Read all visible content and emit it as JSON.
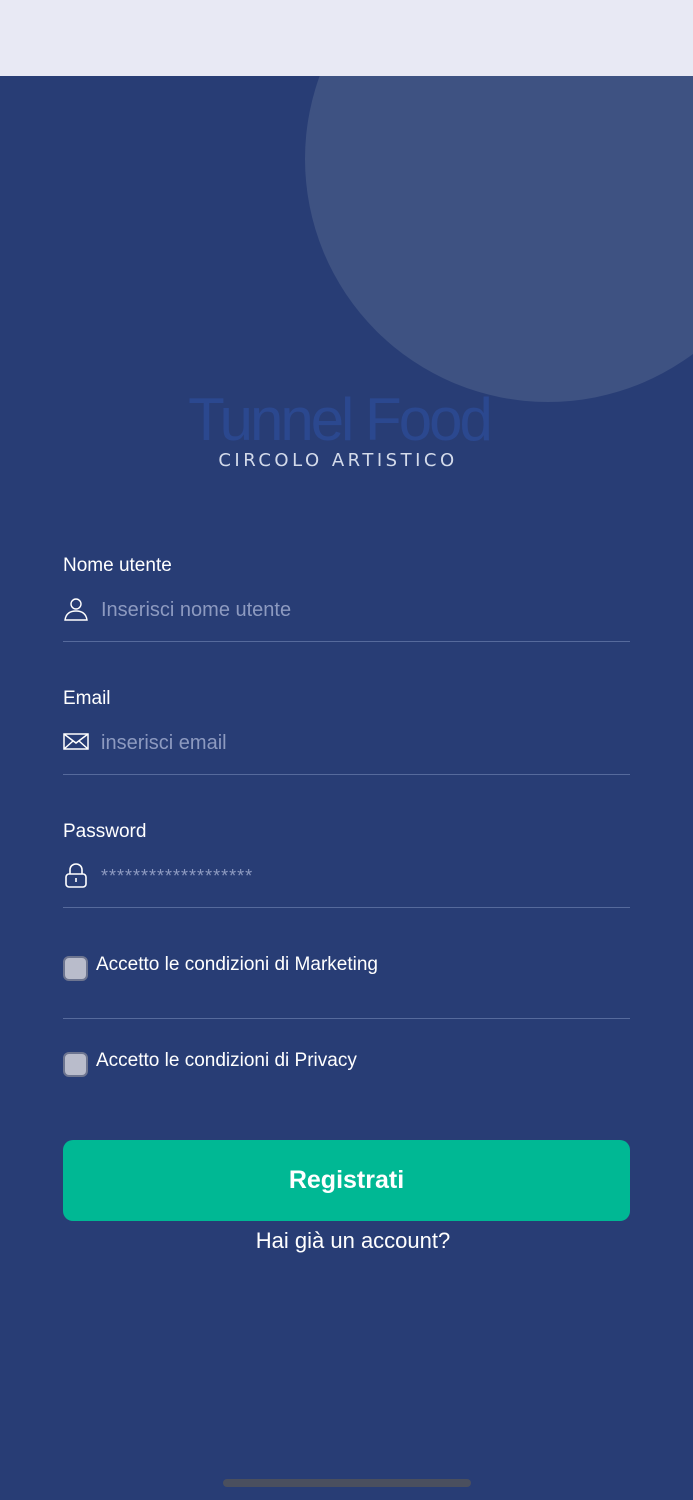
{
  "logo": {
    "script_text": "Tunnel Food",
    "subtitle": "CIRCOLO ARTISTICO"
  },
  "form": {
    "username": {
      "label": "Nome utente",
      "placeholder": "Inserisci nome utente",
      "value": "",
      "icon": "user-icon"
    },
    "email": {
      "label": "Email",
      "placeholder": "inserisci email",
      "value": "",
      "icon": "envelope-icon"
    },
    "password": {
      "label": "Password",
      "placeholder": "*******************",
      "value": "",
      "icon": "lock-icon"
    },
    "marketing": {
      "label": "Accetto le condizioni di Marketing",
      "checked": false
    },
    "privacy": {
      "label": "Accetto le condizioni di Privacy",
      "checked": false
    }
  },
  "actions": {
    "register_label": "Registrati",
    "login_link": "Hai già un account?"
  },
  "colors": {
    "background": "#283d75",
    "accent": "#00b894",
    "status_bar": "#e8e9f4",
    "decor_circle": "#3e5282"
  }
}
